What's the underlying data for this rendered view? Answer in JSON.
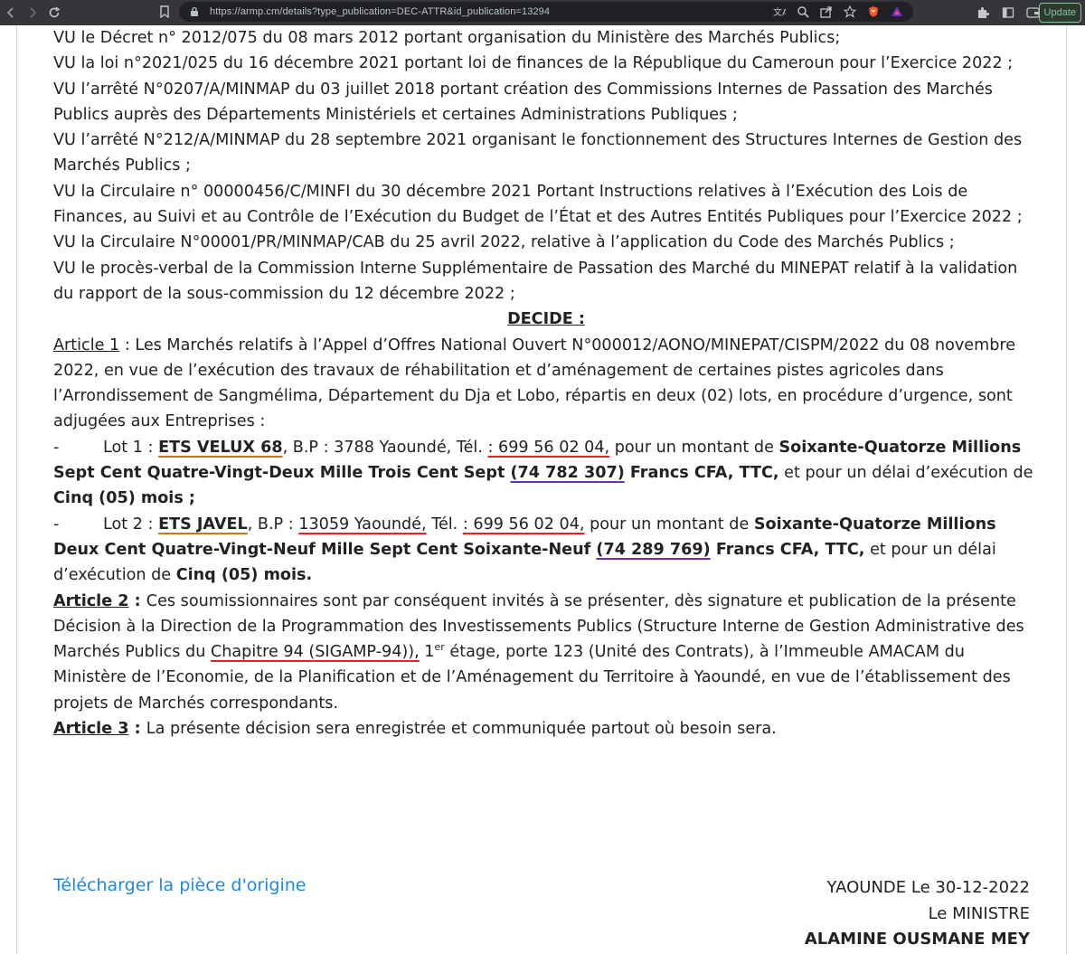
{
  "browser": {
    "url": "https://armp.cm/details?type_publication=DEC-ATTR&id_publication=13294",
    "update_label": "Update"
  },
  "doc": {
    "preamble_clipped": "VU le Décret n° 2012/075 du 08 mars 2012 portant organisation du Ministère des Marchés Publics;",
    "preamble": [
      "VU la loi n°2021/025 du 16 décembre 2021 portant loi de finances de la République du Cameroun pour l’Exercice 2022 ;",
      "VU l’arrêté N°0207/A/MINMAP du 03 juillet 2018 portant création des Commissions Internes de Passation des Marchés Publics auprès des Départements Ministériels et certaines Administrations Publiques ;",
      "VU l’arrêté N°212/A/MINMAP du 28 septembre 2021 organisant le fonctionnement des Structures Internes de Gestion des Marchés Publics ;",
      "VU la Circulaire n° 00000456/C/MINFI du 30 décembre 2021 Portant Instructions relatives à l’Exécution des Lois de Finances, au Suivi et au Contrôle de l’Exécution du Budget de l’État et des Autres Entités Publiques pour l’Exercice 2022 ;",
      "VU la Circulaire N°00001/PR/MINMAP/CAB du 25 avril 2022, relative  à l’application du Code des Marchés Publics ;",
      "VU le procès-verbal de la Commission Interne Supplémentaire de Passation des Marché du MINEPAT relatif à la validation du rapport de la sous-commission du 12 décembre 2022 ;"
    ],
    "decide": "DECIDE :",
    "article1": {
      "label": "Article 1",
      "sep": " : ",
      "text": "Les Marchés relatifs à l’Appel d’Offres National Ouvert N°000012/AONO/MINEPAT/CISPM/2022 du 08 novembre 2022, en vue de l’exécution des travaux de réhabilitation et d’aménagement de certaines pistes agricoles dans l’Arrondissement de Sangmélima, Département du Dja et Lobo, répartis en deux (02) lots, en procédure d’urgence, sont adjugées aux Entreprises :"
    },
    "lot1": {
      "dash": "-",
      "label": "Lot 1 : ",
      "company": "ETS VELUX 68",
      "bp": ", B.P : 3788 Yaoundé, Tél. ",
      "tel": ": 699 56 02 04,",
      "mid": " pour un montant de ",
      "amount_words_a": "Soixante-Quatorze Millions Sept Cent Quatre-Vingt-Deux Mille Trois Cent Sept ",
      "amount_num": "(74 782 307)",
      "amount_words_b": " Francs CFA, TTC,",
      "delay": " et pour un délai d’exécution de ",
      "delay_value": "Cinq (05) mois ;"
    },
    "lot2": {
      "dash": "-",
      "label": "Lot 2 : ",
      "company": "ETS JAVEL",
      "bp": ", B.P : ",
      "city": "13059 Yaoundé,",
      "tel_label": " Tél. ",
      "tel": ": 699 56 02 04,",
      "mid": " pour un montant de ",
      "amount_words_a": "Soixante-Quatorze Millions Deux Cent Quatre-Vingt-Neuf Mille Sept Cent Soixante-Neuf ",
      "amount_num": "(74 289 769)",
      "amount_words_b": " Francs CFA, TTC,",
      "delay": " et pour un délai d’exécution de ",
      "delay_value": "Cinq (05) mois."
    },
    "article2": {
      "label": "Article 2",
      "sep": " : ",
      "text_a": "Ces soumissionnaires sont par conséquent invités à se présenter, dès signature et publication de la présente Décision à la Direction de la Programmation des Investissements Publics (Structure Interne de Gestion Administrative des Marchés Publics du ",
      "chapitre": "Chapitre 94 (SIGAMP-94)),",
      "text_b": " 1",
      "sup": "er",
      "text_c": " étage, porte 123 (Unité des Contrats), à l’Immeuble AMACAM du Ministère de l’Economie, de la Planification et de l’Aménagement du Territoire à Yaoundé, en vue de l’établissement des projets de Marchés correspondants."
    },
    "article3": {
      "label": "Article 3",
      "sep": " : ",
      "text": "La présente décision sera enregistrée et communiquée partout où besoin sera."
    }
  },
  "footer": {
    "download": "Télécharger la pièce d'origine",
    "place_date": "YAOUNDE Le 30-12-2022",
    "role": "Le MINISTRE",
    "name": "ALAMINE OUSMANE MEY"
  }
}
